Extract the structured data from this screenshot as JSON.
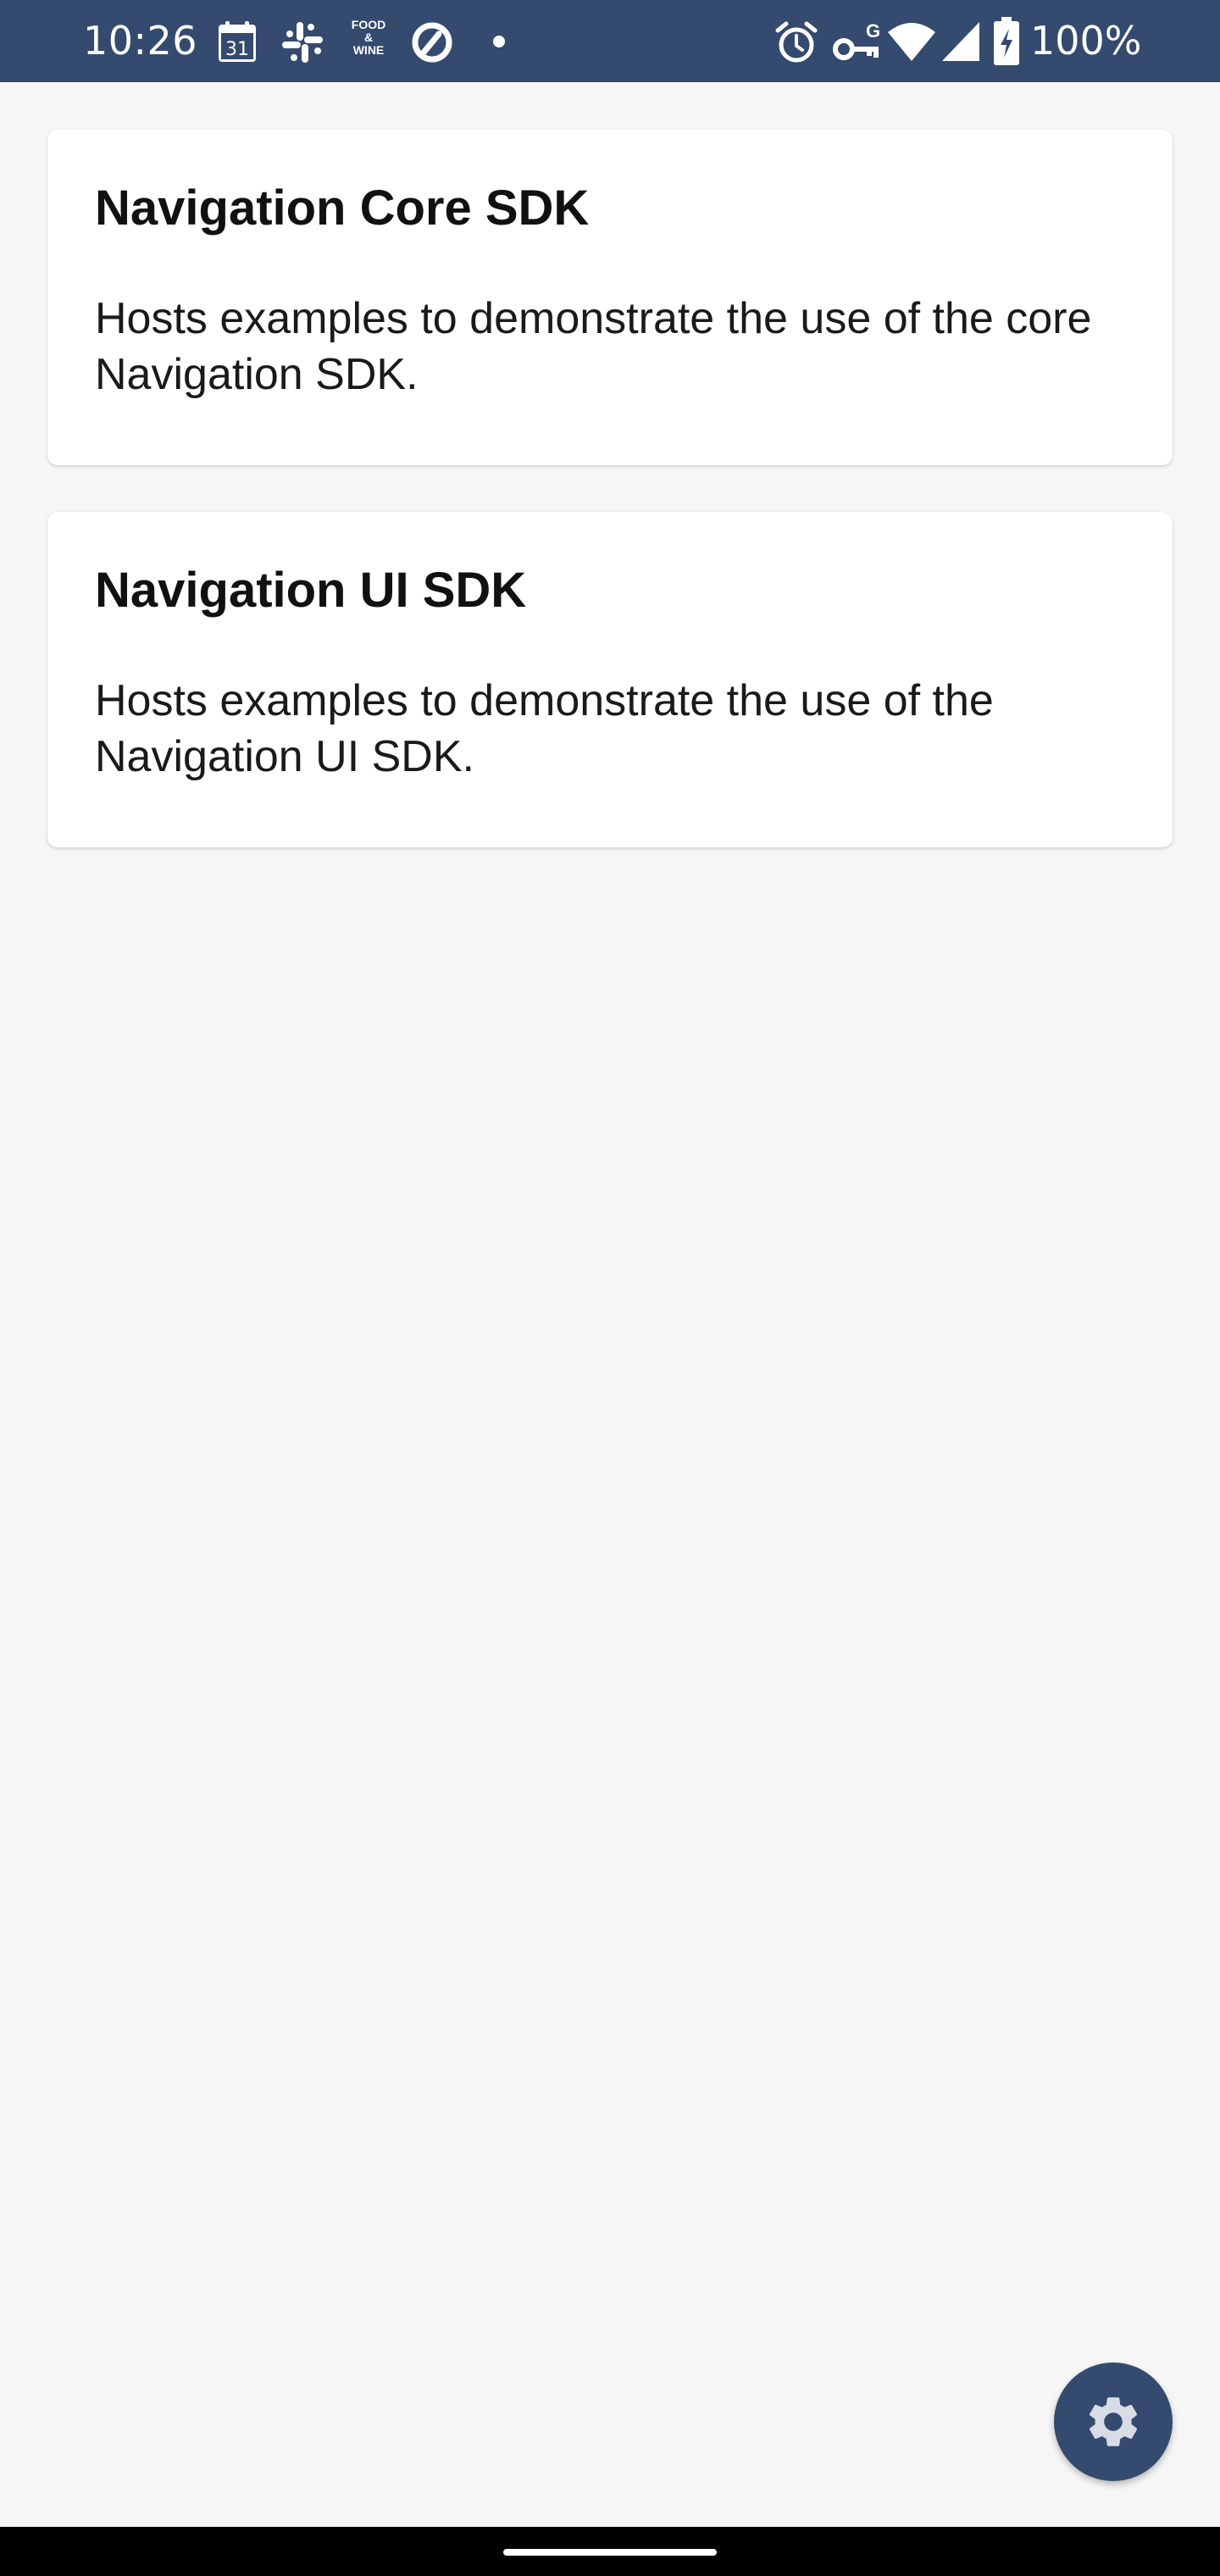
{
  "status_bar": {
    "time": "10:26",
    "calendar_day": "31",
    "food_wine_label": [
      "FOOD",
      "&",
      "WINE"
    ],
    "battery_percent": "100%",
    "icons": [
      "calendar-icon",
      "slack-icon",
      "food-wine-icon",
      "ring-icon",
      "notification-dot-icon",
      "alarm-icon",
      "vpn-key-icon",
      "wifi-icon",
      "cell-signal-icon",
      "battery-charging-icon"
    ]
  },
  "cards": [
    {
      "title": "Navigation Core SDK",
      "description": "Hosts examples to demonstrate the use of the core Navigation SDK."
    },
    {
      "title": "Navigation UI SDK",
      "description": "Hosts examples to demonstrate the use of the Navigation UI SDK."
    }
  ],
  "fab": {
    "icon": "gear-icon"
  },
  "colors": {
    "primary": "#344a6e",
    "background": "#f6f6f6",
    "card": "#ffffff",
    "nav_bar": "#000000"
  }
}
